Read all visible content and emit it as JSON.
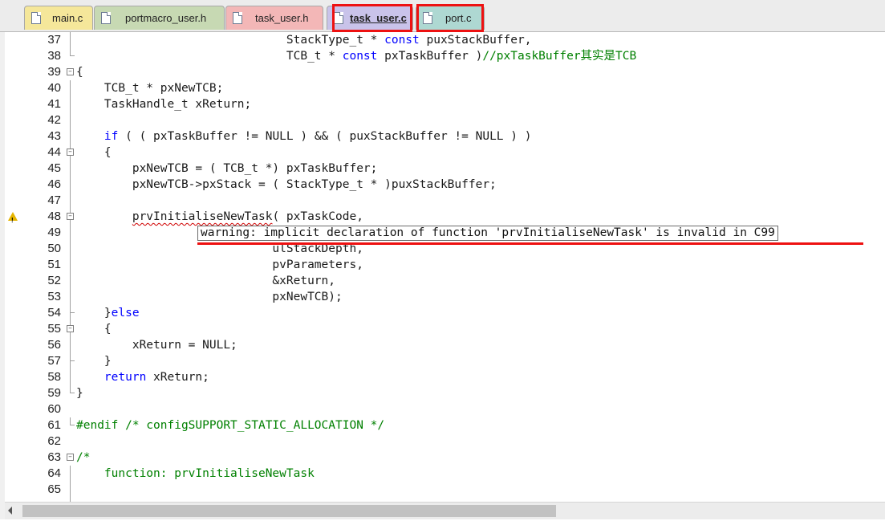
{
  "tabs": [
    {
      "label": "main.c",
      "color": "#f5e79a"
    },
    {
      "label": "portmacro_user.h",
      "color": "#c7d9b3"
    },
    {
      "label": "task_user.h",
      "color": "#f3b7b7"
    },
    {
      "label": "task_user.c",
      "color": "#c9c3ea",
      "active": true
    },
    {
      "label": "port.c",
      "color": "#aed8d2"
    }
  ],
  "lines": [
    {
      "num": "37",
      "code": "                              StackType_t * const puxStackBuffer,"
    },
    {
      "num": "38",
      "code": "                              TCB_t * const pxTaskBuffer )//pxTaskBuffer其实是TCB"
    },
    {
      "num": "39",
      "code": "{"
    },
    {
      "num": "40",
      "code": "    TCB_t * pxNewTCB;"
    },
    {
      "num": "41",
      "code": "    TaskHandle_t xReturn;"
    },
    {
      "num": "42",
      "code": ""
    },
    {
      "num": "43",
      "code": "    if ( ( pxTaskBuffer != NULL ) && ( puxStackBuffer != NULL ) )"
    },
    {
      "num": "44",
      "code": "    {"
    },
    {
      "num": "45",
      "code": "        pxNewTCB = ( TCB_t *) pxTaskBuffer;"
    },
    {
      "num": "46",
      "code": "        pxNewTCB->pxStack = ( StackType_t * )puxStackBuffer;"
    },
    {
      "num": "47",
      "code": ""
    },
    {
      "num": "48",
      "code": "        prvInitialiseNewTask( pxTaskCode,"
    },
    {
      "num": "49",
      "code": ""
    },
    {
      "num": "50",
      "code": "                            ulStackDepth,"
    },
    {
      "num": "51",
      "code": "                            pvParameters,"
    },
    {
      "num": "52",
      "code": "                            &xReturn,"
    },
    {
      "num": "53",
      "code": "                            pxNewTCB);"
    },
    {
      "num": "54",
      "code": "    }else"
    },
    {
      "num": "55",
      "code": "    {"
    },
    {
      "num": "56",
      "code": "        xReturn = NULL;"
    },
    {
      "num": "57",
      "code": "    }"
    },
    {
      "num": "58",
      "code": "    return xReturn;"
    },
    {
      "num": "59",
      "code": "}"
    },
    {
      "num": "60",
      "code": ""
    },
    {
      "num": "61",
      "code": "#endif /* configSUPPORT_STATIC_ALLOCATION */"
    },
    {
      "num": "62",
      "code": ""
    },
    {
      "num": "63",
      "code": "/*"
    },
    {
      "num": "64",
      "code": "    function: prvInitialiseNewTask"
    },
    {
      "num": "65",
      "code": ""
    }
  ],
  "warning_tooltip": "warning: implicit declaration of function 'prvInitialiseNewTask' is invalid in C99",
  "colors": {
    "keyword": "#0000ff",
    "comment": "#008000",
    "highlight_box": "#ee1111",
    "warning_icon": "#e5b400"
  },
  "icons": [
    "file-icon",
    "warning-icon",
    "fold-toggle-icon",
    "scroll-left-arrow-icon"
  ]
}
